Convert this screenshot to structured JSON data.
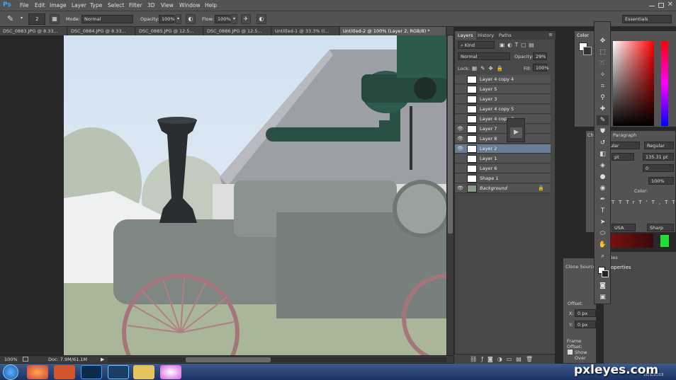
{
  "app": {
    "logo": "Ps"
  },
  "menu": [
    "File",
    "Edit",
    "Image",
    "Layer",
    "Type",
    "Select",
    "Filter",
    "3D",
    "View",
    "Window",
    "Help"
  ],
  "options": {
    "brush_size": "2",
    "mode_label": "Mode:",
    "mode_value": "Normal",
    "opacity_label": "Opacity:",
    "opacity_value": "100%",
    "flow_label": "Flow:",
    "flow_value": "100%",
    "workspace": "Essentials"
  },
  "doc_tabs": [
    {
      "label": "DSC_0883.JPG @ 8.33..."
    },
    {
      "label": "DSC_0884.JPG @ 8.33..."
    },
    {
      "label": "DSC_0885.JPG @ 12.5..."
    },
    {
      "label": "DSC_0886.JPG @ 12.5..."
    },
    {
      "label": "Untitled-1 @ 33.3% (I..."
    },
    {
      "label": "Untitled-2 @ 100% (Layer 2, RGB/8) *"
    }
  ],
  "status": {
    "zoom": "100%",
    "doc": "Doc: 7.9M/61.1M"
  },
  "layers_panel": {
    "tabs": [
      "Layers",
      "History",
      "Paths"
    ],
    "filter": "Kind",
    "blend": "Normal",
    "opacity_label": "Opacity:",
    "opacity": "29%",
    "lock_label": "Lock:",
    "fill_label": "Fill:",
    "fill": "100%",
    "layers": [
      {
        "name": "Layer 4 copy 4",
        "visible": false
      },
      {
        "name": "Layer 5",
        "visible": false
      },
      {
        "name": "Layer 3",
        "visible": false
      },
      {
        "name": "Layer 4 copy 5",
        "visible": false
      },
      {
        "name": "Layer 4 copy 3",
        "visible": false
      },
      {
        "name": "Layer 7",
        "visible": true
      },
      {
        "name": "Layer 8",
        "visible": true
      },
      {
        "name": "Layer 2",
        "visible": true,
        "selected": true
      },
      {
        "name": "Layer 1",
        "visible": false
      },
      {
        "name": "Layer 6",
        "visible": false
      },
      {
        "name": "Shape 1",
        "visible": false
      },
      {
        "name": "Background",
        "visible": true
      }
    ]
  },
  "color_panel": {
    "tab": "Color"
  },
  "char_panel": {
    "tabs": [
      "Cha",
      "Paragraph"
    ],
    "style": "Regular",
    "font": "ular",
    "size": "pt",
    "leading": "135.31 pt",
    "tracking": "0",
    "scale": "100%",
    "color_label": "Color:",
    "language": "USA",
    "aa": "Sharp",
    "glyphs": [
      "TT",
      "Tr",
      "T'",
      "T,",
      "T",
      "T"
    ]
  },
  "clone_panel": {
    "title": "Clone Source",
    "offset_label": "Offset:",
    "x_label": "X:",
    "x_value": "0 px",
    "y_label": "Y:",
    "y_value": "0 px",
    "frame_label": "Frame Offset:",
    "show_label": "Show Over"
  },
  "prop_panel": {
    "tab_label": "ties",
    "title": "operties"
  },
  "watermark": "pxleyes.com",
  "clock": "10/1/2013",
  "colors": {
    "accent": "#31a8ff",
    "selected_layer": "#6a7d96"
  }
}
